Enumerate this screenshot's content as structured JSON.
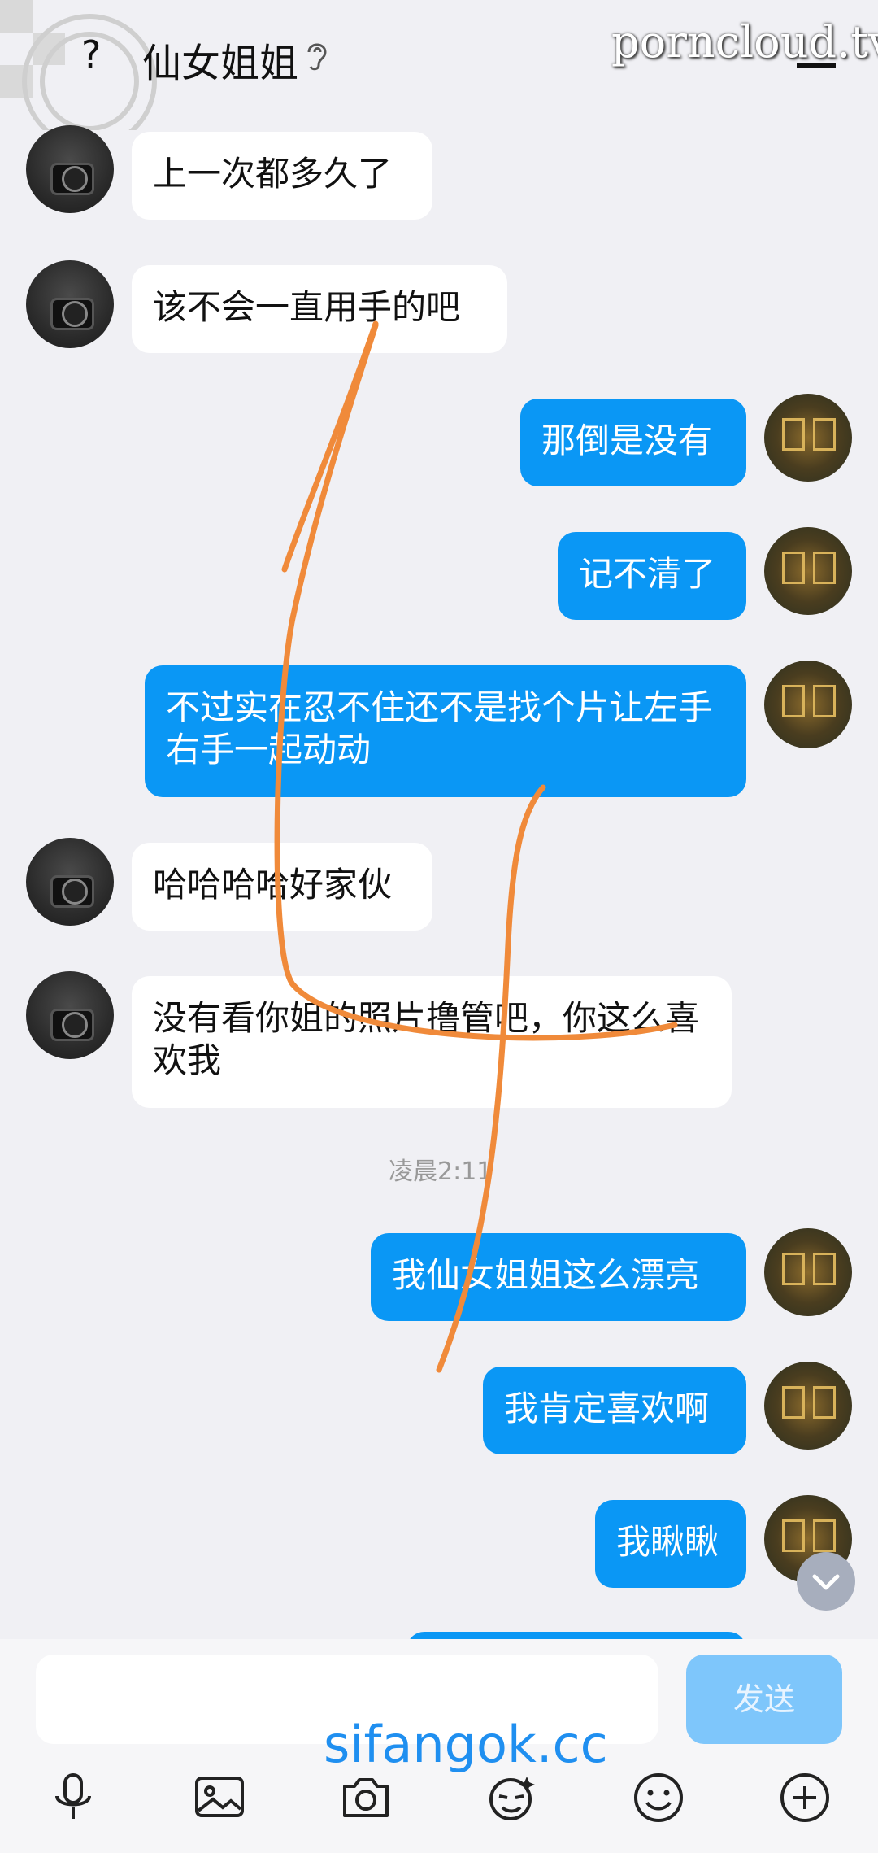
{
  "header": {
    "back_glyph": "?",
    "title": "仙女姐姐",
    "watermark": "porncloud.tv"
  },
  "messages": [
    {
      "side": "in",
      "text": "上一次都多久了"
    },
    {
      "side": "in",
      "text": "该不会一直用手的吧"
    },
    {
      "side": "out",
      "text": "那倒是没有"
    },
    {
      "side": "out",
      "text": "记不清了"
    },
    {
      "side": "out",
      "text": "不过实在忍不住还不是找个片让左手右手一起动动"
    },
    {
      "side": "in",
      "text": "哈哈哈哈好家伙"
    },
    {
      "side": "in",
      "text": "没有看你姐的照片撸管吧，你这么喜欢我"
    },
    {
      "side": "out",
      "text": "我仙女姐姐这么漂亮"
    },
    {
      "side": "out",
      "text": "我肯定喜欢啊"
    },
    {
      "side": "out",
      "text": "我瞅瞅"
    }
  ],
  "timestamp": "凌晨2:11",
  "composer": {
    "placeholder": "",
    "send_label": "发送",
    "watermark": "sifangok.cc"
  },
  "toolbar": [
    "microphone-icon",
    "image-icon",
    "camera-icon",
    "sticker-icon",
    "emoji-icon",
    "plus-icon"
  ],
  "colors": {
    "background": "#f0f0f4",
    "incoming_bubble": "#ffffff",
    "outgoing_bubble": "#0a97f5",
    "send_button": "#7ec6fb",
    "annotation_stroke": "#f08a3a"
  }
}
